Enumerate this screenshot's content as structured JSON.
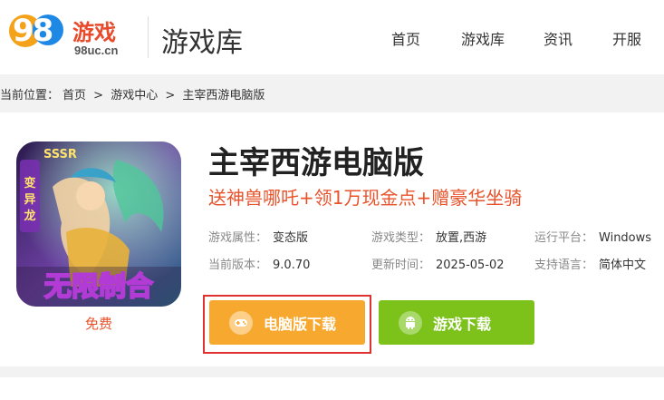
{
  "header": {
    "logo": {
      "number": "98",
      "name": "游戏",
      "domain": "98uc.cn"
    },
    "site_title": "游戏库",
    "nav": [
      {
        "label": "首页"
      },
      {
        "label": "游戏库"
      },
      {
        "label": "资讯"
      },
      {
        "label": "开服"
      }
    ]
  },
  "breadcrumb": {
    "prefix": "当前位置：",
    "items": [
      "首页",
      "游戏中心",
      "主宰西游电脑版"
    ],
    "separator": ">"
  },
  "game": {
    "title": "主宰西游电脑版",
    "promo": "送神兽哪吒+领1万现金点+赠豪华坐骑",
    "icon": {
      "name": "game-cover-icon",
      "text": "无限制合"
    },
    "price_label": "免费",
    "info": {
      "attribute": {
        "key": "游戏属性：",
        "value": "变态版"
      },
      "type": {
        "key": "游戏类型：",
        "value": "放置,西游"
      },
      "platform": {
        "key": "运行平台：",
        "value": "Windows"
      },
      "version": {
        "key": "当前版本：",
        "value": "9.0.70"
      },
      "updated": {
        "key": "更新时间：",
        "value": "2025-05-02"
      },
      "language": {
        "key": "支持语言：",
        "value": "简体中文"
      }
    }
  },
  "buttons": {
    "pc_download": {
      "label": "电脑版下载",
      "icon": "gamepad-icon",
      "color": "#f7a82f"
    },
    "game_download": {
      "label": "游戏下载",
      "icon": "android-icon",
      "color": "#7cc21a"
    }
  },
  "colors": {
    "accent": "#e8532b",
    "highlight": "#e03131"
  }
}
